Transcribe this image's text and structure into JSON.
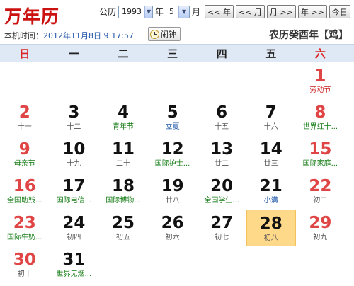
{
  "app": {
    "title": "万年历"
  },
  "controls": {
    "calendar_label": "公历",
    "year_value": "1993",
    "year_unit": "年",
    "month_value": "5",
    "month_unit": "月",
    "prev_year": "<< 年",
    "prev_month": "<< 月",
    "next_month": "月 >>",
    "next_year": "年 >>",
    "today": "今日"
  },
  "info": {
    "time_label": "本机时间：",
    "time_value": "2012年11月8日 9:17:57",
    "alarm_label": "闹钟",
    "lunar_year": "农历癸酉年【鸡】"
  },
  "weekdays": [
    "日",
    "一",
    "二",
    "三",
    "四",
    "五",
    "六"
  ],
  "weeks": [
    [
      null,
      null,
      null,
      null,
      null,
      null,
      {
        "day": "1",
        "sub": "劳动节",
        "style": "holiday-red"
      }
    ],
    [
      {
        "day": "2",
        "sub": "十一",
        "style": "plain"
      },
      {
        "day": "3",
        "sub": "十二",
        "style": "plain"
      },
      {
        "day": "4",
        "sub": "青年节",
        "style": "holiday-green"
      },
      {
        "day": "5",
        "sub": "立夏",
        "style": "term"
      },
      {
        "day": "6",
        "sub": "十五",
        "style": "plain"
      },
      {
        "day": "7",
        "sub": "十六",
        "style": "plain"
      },
      {
        "day": "8",
        "sub": "世界红十...",
        "style": "holiday-green"
      }
    ],
    [
      {
        "day": "9",
        "sub": "母亲节",
        "style": "holiday-green"
      },
      {
        "day": "10",
        "sub": "十九",
        "style": "plain"
      },
      {
        "day": "11",
        "sub": "二十",
        "style": "plain"
      },
      {
        "day": "12",
        "sub": "国际护士...",
        "style": "holiday-green"
      },
      {
        "day": "13",
        "sub": "廿二",
        "style": "plain"
      },
      {
        "day": "14",
        "sub": "廿三",
        "style": "plain"
      },
      {
        "day": "15",
        "sub": "国际家庭...",
        "style": "holiday-green"
      }
    ],
    [
      {
        "day": "16",
        "sub": "全国助残...",
        "style": "holiday-green"
      },
      {
        "day": "17",
        "sub": "国际电信...",
        "style": "holiday-green"
      },
      {
        "day": "18",
        "sub": "国际博物...",
        "style": "holiday-green"
      },
      {
        "day": "19",
        "sub": "廿八",
        "style": "plain"
      },
      {
        "day": "20",
        "sub": "全国学生...",
        "style": "holiday-green"
      },
      {
        "day": "21",
        "sub": "小满",
        "style": "term"
      },
      {
        "day": "22",
        "sub": "初二",
        "style": "plain"
      }
    ],
    [
      {
        "day": "23",
        "sub": "国际牛奶...",
        "style": "holiday-green"
      },
      {
        "day": "24",
        "sub": "初四",
        "style": "plain"
      },
      {
        "day": "25",
        "sub": "初五",
        "style": "plain"
      },
      {
        "day": "26",
        "sub": "初六",
        "style": "plain"
      },
      {
        "day": "27",
        "sub": "初七",
        "style": "plain"
      },
      {
        "day": "28",
        "sub": "初八",
        "style": "plain",
        "selected": true
      },
      {
        "day": "29",
        "sub": "初九",
        "style": "plain"
      }
    ],
    [
      {
        "day": "30",
        "sub": "初十",
        "style": "plain"
      },
      {
        "day": "31",
        "sub": "世界无烟...",
        "style": "holiday-green"
      },
      null,
      null,
      null,
      null,
      null
    ]
  ],
  "colors": {
    "weekend": "#e04545",
    "holiday_red": "#cc2222",
    "holiday_green": "#117a11",
    "solar_term": "#1d55a8",
    "selected_bg": "#ffd98a",
    "header_bg": "#dfe8f5"
  }
}
